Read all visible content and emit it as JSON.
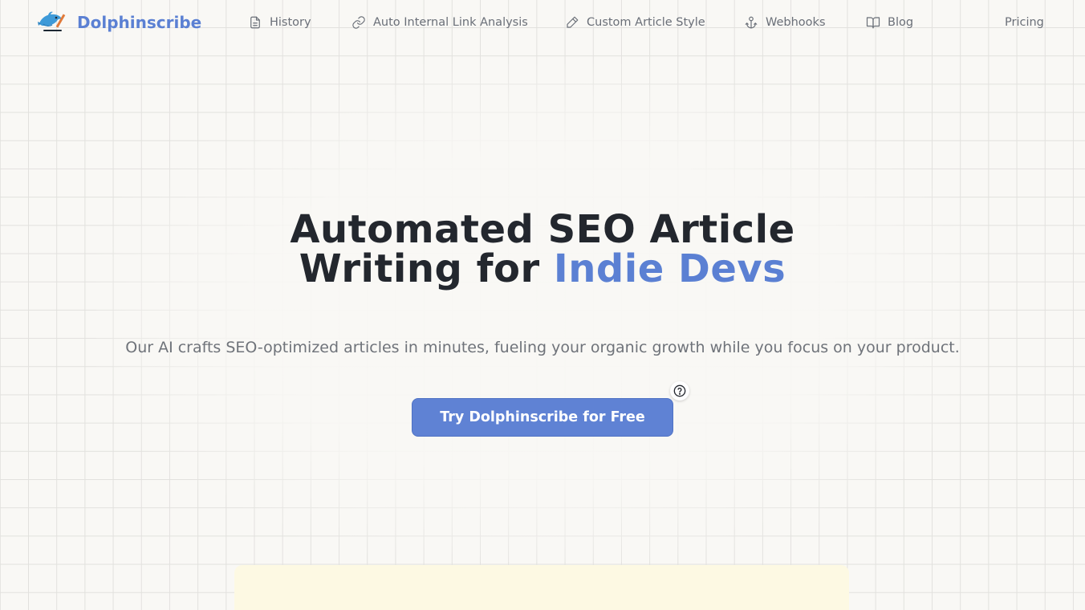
{
  "nav": {
    "brand": "Dolphinscribe",
    "links": [
      {
        "label": "History",
        "icon": "document-icon"
      },
      {
        "label": "Auto Internal Link Analysis",
        "icon": "link-icon"
      },
      {
        "label": "Custom Article Style",
        "icon": "pen-icon"
      },
      {
        "label": "Webhooks",
        "icon": "webhook-icon"
      },
      {
        "label": "Blog",
        "icon": "book-open-icon"
      }
    ],
    "pricing": "Pricing"
  },
  "hero": {
    "title_line1": "Automated SEO Article",
    "title_line2_prefix": "Writing for ",
    "title_line2_accent": "Indie Devs",
    "subtitle": "Our AI crafts SEO-optimized articles in minutes, fueling your organic growth while you focus on your product.",
    "cta": "Try Dolphinscribe for Free",
    "help_icon": "question-circle-icon"
  },
  "colors": {
    "accent": "#5b80d3",
    "cta_bg": "#5f82d4",
    "text": "#23272e",
    "muted": "#6f737a",
    "card_bg": "#fdf9e3",
    "highlight": "#e4a01a"
  }
}
